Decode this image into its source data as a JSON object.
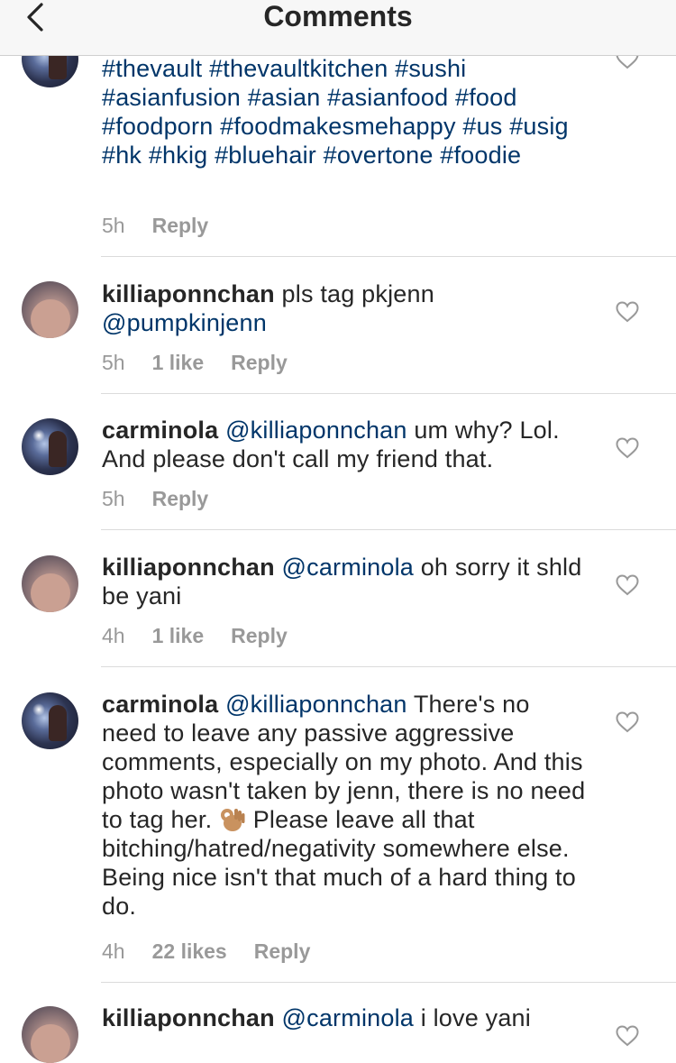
{
  "header": {
    "title": "Comments"
  },
  "comments": [
    {
      "user": "",
      "text": "",
      "hashtags": "#thevault #thevaultkitchen #sushi #asianfusion #asian #asianfood #food #foodporn #foodmakesmehappy #us #usig #hk #hkig #bluehair #overtone #foodie",
      "time": "5h",
      "likes": "",
      "reply": "Reply"
    },
    {
      "user": "killiaponnchan",
      "text": "pls tag pkjenn",
      "mention_after": "@pumpkinjenn",
      "time": "5h",
      "likes": "1 like",
      "reply": "Reply"
    },
    {
      "user": "carminola",
      "mention": "@killiaponnchan",
      "text": "um why? Lol. And please don't call my friend that.",
      "time": "5h",
      "likes": "",
      "reply": "Reply"
    },
    {
      "user": "killiaponnchan",
      "mention": "@carminola",
      "text": "oh sorry it shld be yani",
      "time": "4h",
      "likes": "1 like",
      "reply": "Reply"
    },
    {
      "user": "carminola",
      "mention": "@killiaponnchan",
      "text_a": "There's no need to leave any passive aggressive comments, especially on my photo. And this photo wasn't taken by jenn, there is no need to tag her.",
      "emoji": "ok-hand-icon",
      "text_b": "Please leave all that bitching/hatred/negativity somewhere else. Being nice isn't that much of a hard thing to do.",
      "time": "4h",
      "likes": "22 likes",
      "reply": "Reply"
    },
    {
      "user": "killiaponnchan",
      "mention": "@carminola",
      "text": "i love yani",
      "time": "",
      "likes": "",
      "reply": ""
    }
  ],
  "colors": {
    "mention": "#003569",
    "meta": "#999999",
    "text": "#262626",
    "header_bg": "#f7f7f7"
  }
}
